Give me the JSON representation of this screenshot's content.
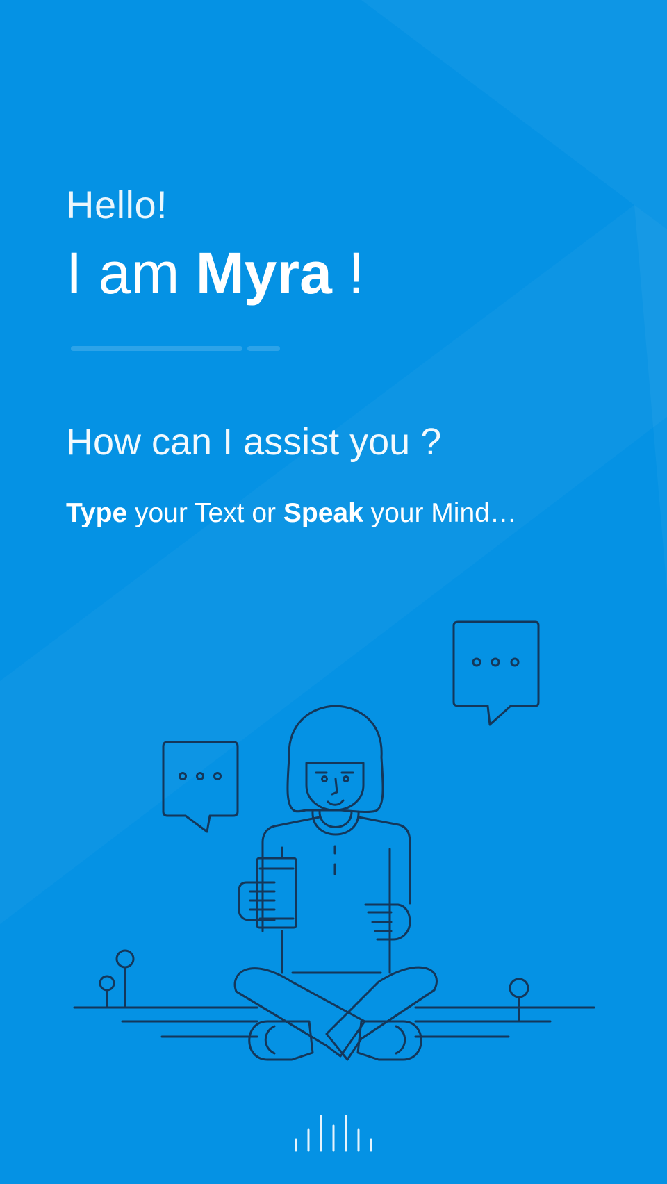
{
  "colors": {
    "background": "#0592e4",
    "text": "#ffffff",
    "line_art": "#14375a"
  },
  "greeting": "Hello!",
  "intro": {
    "prefix": "I am ",
    "name": "Myra",
    "suffix": " !"
  },
  "question": "How can I assist you ?",
  "instruction": {
    "word1": "Type",
    "mid": " your Text or ",
    "word2": "Speak",
    "end": " your Mind…"
  },
  "illustration": {
    "subject": "person sitting cross-legged holding a phone",
    "icons": [
      "speech-bubble-left-icon",
      "speech-bubble-right-icon"
    ]
  },
  "voice_button": {
    "icon": "voice-waveform-icon"
  }
}
